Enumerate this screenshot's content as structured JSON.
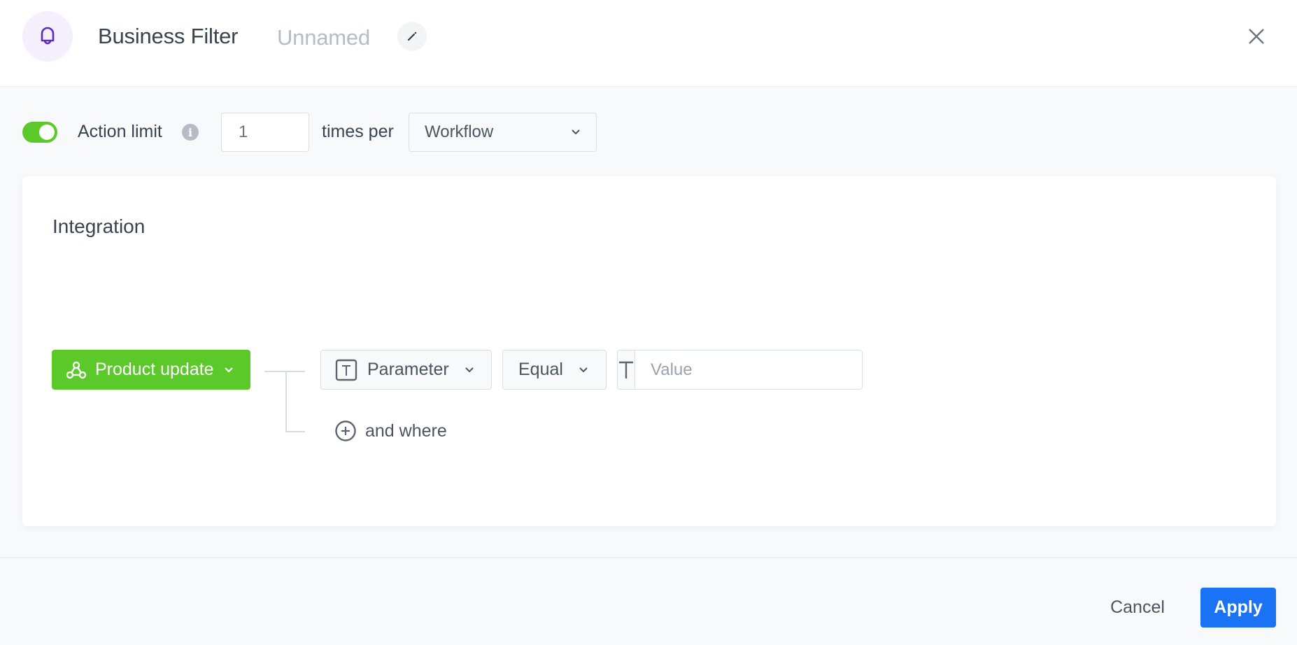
{
  "header": {
    "icon": "bell-icon",
    "title": "Business Filter",
    "subtitle": "Unnamed",
    "edit_icon": "pencil-icon",
    "close_icon": "close-icon"
  },
  "action_limit": {
    "enabled": true,
    "label": "Action limit",
    "info_icon": "info-icon",
    "value": "1",
    "times_per_label": "times per",
    "period": "Workflow"
  },
  "card": {
    "title": "Integration",
    "event": {
      "label": "Product update",
      "icon": "webhook-icon",
      "color": "#5bc92a"
    },
    "condition": {
      "parameter_label": "Parameter",
      "parameter_type_icon": "text-type-icon",
      "operator": "Equal",
      "value_type_icon": "text-type-icon",
      "value": "",
      "value_placeholder": "Value"
    },
    "add_condition_label": "and where"
  },
  "footer": {
    "cancel_label": "Cancel",
    "apply_label": "Apply",
    "apply_color": "#1a72f5"
  }
}
